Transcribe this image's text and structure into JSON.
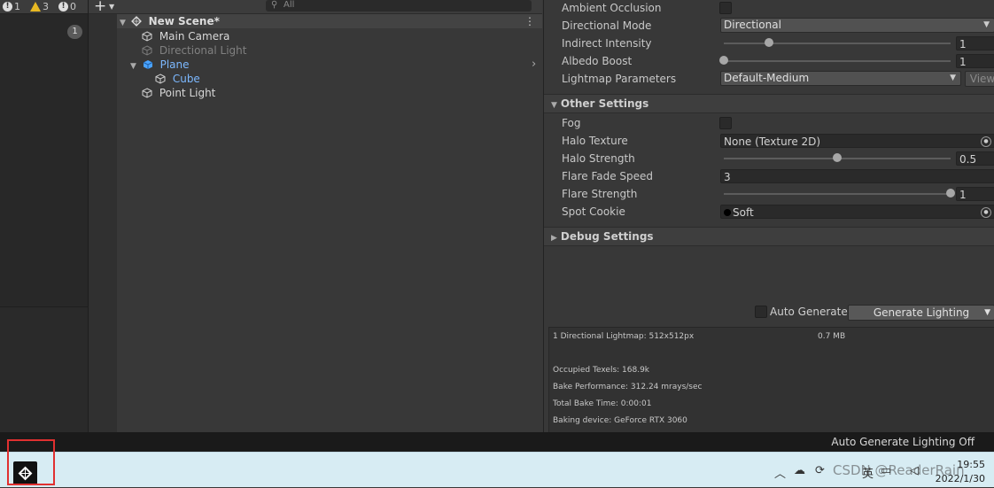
{
  "console": {
    "info_count": "1",
    "warning_count": "3",
    "error_count": "0",
    "badge": "1"
  },
  "hierarchy": {
    "search_placeholder": "All",
    "scene_name": "New Scene*",
    "items": [
      {
        "label": "Main Camera",
        "style": "normal"
      },
      {
        "label": "Directional Light",
        "style": "disabled"
      },
      {
        "label": "Plane",
        "style": "prefab"
      },
      {
        "label": "Cube",
        "style": "prefab-child"
      },
      {
        "label": "Point Light",
        "style": "normal"
      }
    ]
  },
  "lighting": {
    "ambient_occlusion": "Ambient Occlusion",
    "directional_mode_label": "Directional Mode",
    "directional_mode_value": "Directional",
    "indirect_intensity_label": "Indirect Intensity",
    "indirect_intensity_value": "1",
    "albedo_boost_label": "Albedo Boost",
    "albedo_boost_value": "1",
    "lightmap_params_label": "Lightmap Parameters",
    "lightmap_params_value": "Default-Medium",
    "view_button": "View",
    "other_settings_header": "Other Settings",
    "fog_label": "Fog",
    "halo_texture_label": "Halo Texture",
    "halo_texture_value": "None (Texture 2D)",
    "halo_strength_label": "Halo Strength",
    "halo_strength_value": "0.5",
    "flare_fade_label": "Flare Fade Speed",
    "flare_fade_value": "3",
    "flare_strength_label": "Flare Strength",
    "flare_strength_value": "1",
    "spot_cookie_label": "Spot Cookie",
    "spot_cookie_value": "Soft",
    "debug_settings_header": "Debug Settings",
    "auto_generate_label": "Auto Generate",
    "generate_lighting_button": "Generate Lighting"
  },
  "sliders": {
    "indirect_intensity_fraction": 0.2,
    "albedo_boost_fraction": 0.0,
    "halo_strength_fraction": 0.5,
    "flare_strength_fraction": 1.0
  },
  "stats": {
    "lightmap_line": "1 Directional Lightmap: 512x512px",
    "lightmap_size": "0.7 MB",
    "occupied_texels": "Occupied Texels: 168.9k",
    "bake_performance": "Bake Performance: 312.24 mrays/sec",
    "total_bake_time": "Total Bake Time: 0:00:01",
    "baking_device": "Baking device: GeForce RTX 3060"
  },
  "status_bar": {
    "message": "Auto Generate Lighting Off"
  },
  "taskbar": {
    "ime": "英",
    "time": "19:55",
    "date": "2022/1/30",
    "watermark": "CSDN @ReaderRain"
  },
  "colors": {
    "accent_prefab": "#7cb8ff",
    "warning": "#e8b923",
    "highlight": "#e03030"
  }
}
